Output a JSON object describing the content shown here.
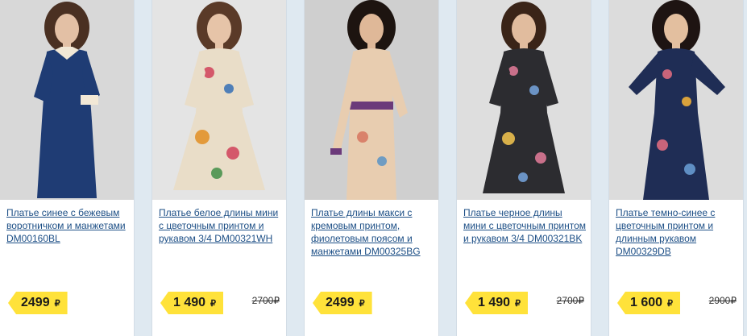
{
  "products": [
    {
      "title": "Платье синее с бежевым воротничком и манжетами DM00160BL",
      "price": "2499",
      "currency": "₽",
      "old_price": "",
      "dress_color": "#1f3c74",
      "background": "#d8d8d8"
    },
    {
      "title": "Платье белое длины мини с цветочным принтом и рукавом 3/4 DM00321WH",
      "price": "1 490",
      "currency": "₽",
      "old_price": "2700₽",
      "dress_color": "#e9ddc8",
      "background": "#e4e4e4"
    },
    {
      "title": "Платье длины макси с кремовым принтом, фиолетовым поясом и манжетами DM00325BG",
      "price": "2499",
      "currency": "₽",
      "old_price": "",
      "dress_color": "#e8cdb0",
      "background": "#cfcfcf"
    },
    {
      "title": "Платье черное длины мини с цветочным принтом и рукавом 3/4 DM00321BK",
      "price": "1 490",
      "currency": "₽",
      "old_price": "2700₽",
      "dress_color": "#2c2c30",
      "background": "#dedede"
    },
    {
      "title": "Платье темно-синее с цветочным принтом и длинным рукавом DM00329DB",
      "price": "1 600",
      "currency": "₽",
      "old_price": "2900₽",
      "dress_color": "#1f2d55",
      "background": "#dcdcdc"
    }
  ]
}
